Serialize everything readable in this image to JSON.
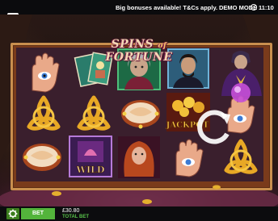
{
  "status_bar": {
    "promo_text": "Big bonuses available! T&Cs apply.",
    "mode_text": "DEMO MODE",
    "time": "11:10"
  },
  "game": {
    "title_part1": "SPINS",
    "title_of": "of",
    "title_part2": "FORTUNE",
    "symbols": {
      "jackpot_label": "JACKPOT",
      "wild_label": "WILD"
    }
  },
  "footer": {
    "bet_label": "BET",
    "balance": "£30.80",
    "total_bet_label": "TOTAL BET"
  },
  "colors": {
    "accent_green": "#53b43b",
    "frame_gold": "#c98f4e"
  },
  "icons": [
    "menu-icon",
    "clock-icon",
    "gear-icon",
    "reload-icon"
  ]
}
